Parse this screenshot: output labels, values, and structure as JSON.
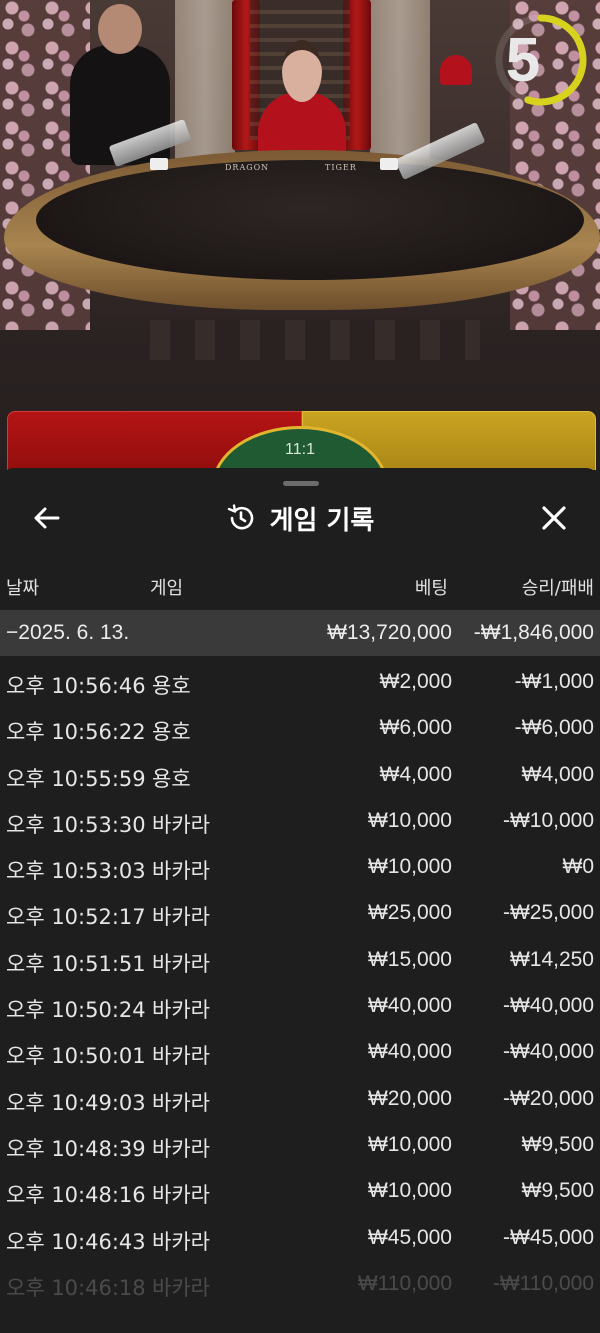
{
  "video": {
    "table_text_left": "DRAGON",
    "table_text_right": "TIGER",
    "countdown": "5",
    "countdown_fraction": 0.55,
    "tie_label": "11:1",
    "colors": {
      "dragon": "#b41414",
      "tiger": "#c9a421",
      "tie": "#1f5a32",
      "timer_ring": "#d7d21e"
    }
  },
  "sheet": {
    "title": "게임 기록",
    "back_icon": "arrow-left-icon",
    "history_icon": "history-icon",
    "close_icon": "close-icon",
    "columns": {
      "date": "날짜",
      "game": "게임",
      "bet": "베팅",
      "result": "승리/패배"
    },
    "date_group": {
      "date": "−2025. 6. 13.",
      "bet": "₩13,720,000",
      "result": "-₩1,846,000"
    },
    "rows": [
      {
        "time": "오후 10:56:46",
        "game": "용호",
        "bet": "₩2,000",
        "result": "-₩1,000"
      },
      {
        "time": "오후 10:56:22",
        "game": "용호",
        "bet": "₩6,000",
        "result": "-₩6,000"
      },
      {
        "time": "오후 10:55:59",
        "game": "용호",
        "bet": "₩4,000",
        "result": "₩4,000"
      },
      {
        "time": "오후 10:53:30",
        "game": "바카라",
        "bet": "₩10,000",
        "result": "-₩10,000"
      },
      {
        "time": "오후 10:53:03",
        "game": "바카라",
        "bet": "₩10,000",
        "result": "₩0"
      },
      {
        "time": "오후 10:52:17",
        "game": "바카라",
        "bet": "₩25,000",
        "result": "-₩25,000"
      },
      {
        "time": "오후 10:51:51",
        "game": "바카라",
        "bet": "₩15,000",
        "result": "₩14,250"
      },
      {
        "time": "오후 10:50:24",
        "game": "바카라",
        "bet": "₩40,000",
        "result": "-₩40,000"
      },
      {
        "time": "오후 10:50:01",
        "game": "바카라",
        "bet": "₩40,000",
        "result": "-₩40,000"
      },
      {
        "time": "오후 10:49:03",
        "game": "바카라",
        "bet": "₩20,000",
        "result": "-₩20,000"
      },
      {
        "time": "오후 10:48:39",
        "game": "바카라",
        "bet": "₩10,000",
        "result": "₩9,500"
      },
      {
        "time": "오후 10:48:16",
        "game": "바카라",
        "bet": "₩10,000",
        "result": "₩9,500"
      },
      {
        "time": "오후 10:46:43",
        "game": "바카라",
        "bet": "₩45,000",
        "result": "-₩45,000"
      },
      {
        "time": "오후 10:46:18",
        "game": "바카라",
        "bet": "₩110,000",
        "result": "-₩110,000"
      }
    ]
  }
}
